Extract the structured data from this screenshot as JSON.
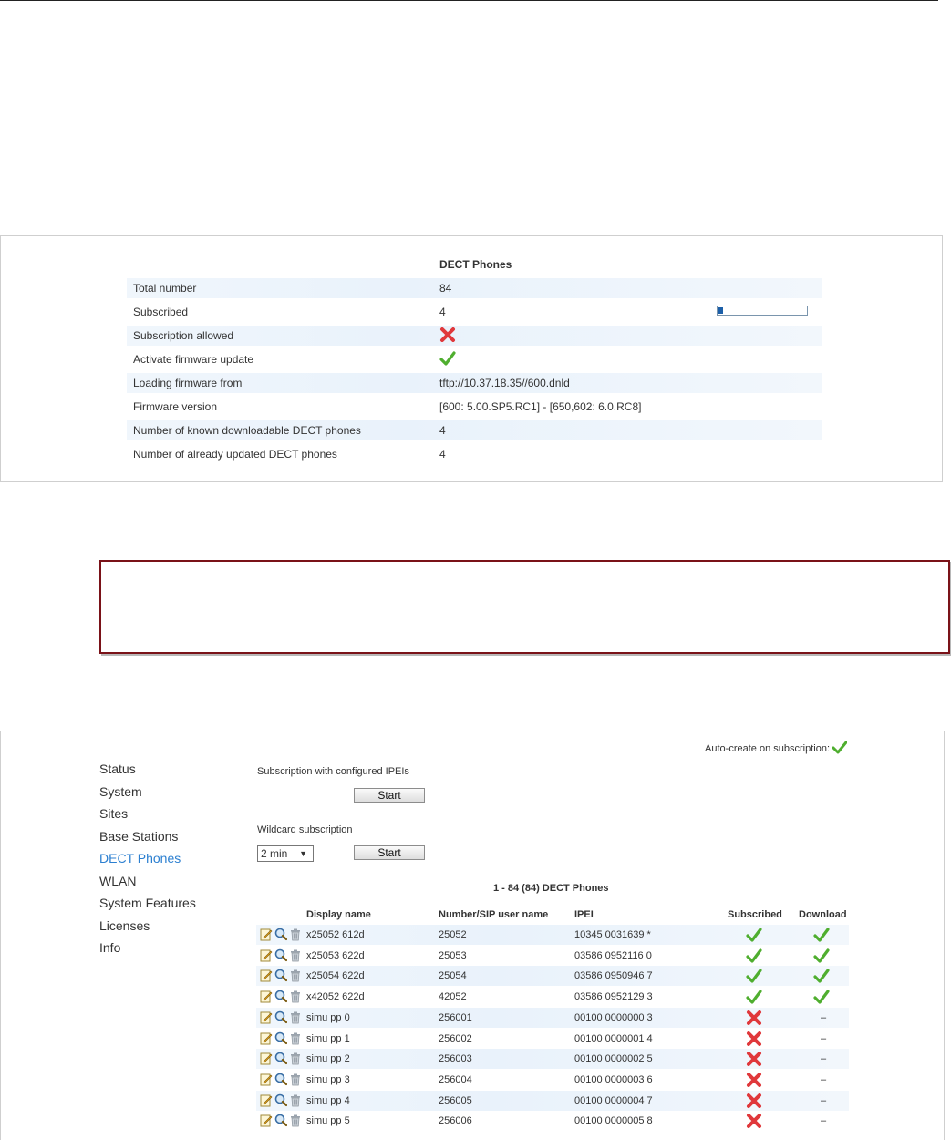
{
  "dect_panel": {
    "heading": "DECT Phones",
    "rows": [
      {
        "label": "Total number",
        "value": "84"
      },
      {
        "label": "Subscribed",
        "value": "4"
      },
      {
        "label": "Subscription allowed",
        "value": ""
      },
      {
        "label": "Activate firmware update",
        "value": ""
      },
      {
        "label": "Loading firmware from",
        "value": "tftp://10.37.18.35//600.dnld"
      },
      {
        "label": "Firmware version",
        "value": "[600: 5.00.SP5.RC1] - [650,602: 6.0.RC8]"
      },
      {
        "label": "Number of known downloadable DECT phones",
        "value": "4"
      },
      {
        "label": "Number of already updated DECT phones",
        "value": "4"
      }
    ],
    "subscribed_progress_fraction": 0.05,
    "subscription_allowed_icon": "red-cross-icon",
    "firmware_update_icon": "green-check-icon"
  },
  "nav": {
    "items": [
      "Status",
      "System",
      "Sites",
      "Base Stations",
      "DECT Phones",
      "WLAN",
      "System Features",
      "Licenses",
      "Info"
    ],
    "active": "DECT Phones"
  },
  "subscription": {
    "auto_create_label": "Auto-create on subscription:",
    "configured_label": "Subscription with configured IPEIs",
    "start_label": "Start",
    "wildcard_label": "Wildcard subscription",
    "wildcard_duration": "2 min"
  },
  "phones_table": {
    "title": "1 - 84 (84) DECT Phones",
    "headers": [
      "Display name",
      "Number/SIP user name",
      "IPEI",
      "Subscribed",
      "Download"
    ],
    "rows": [
      {
        "name": "x25052 612d",
        "number": "25052",
        "ipei": "10345 0031639 *",
        "subscribed": true,
        "download": "ok"
      },
      {
        "name": "x25053 622d",
        "number": "25053",
        "ipei": "03586 0952116 0",
        "subscribed": true,
        "download": "ok"
      },
      {
        "name": "x25054 622d",
        "number": "25054",
        "ipei": "03586 0950946 7",
        "subscribed": true,
        "download": "ok"
      },
      {
        "name": "x42052 622d",
        "number": "42052",
        "ipei": "03586 0952129 3",
        "subscribed": true,
        "download": "ok"
      },
      {
        "name": "simu pp 0",
        "number": "256001",
        "ipei": "00100 0000000 3",
        "subscribed": false,
        "download": "–"
      },
      {
        "name": "simu pp 1",
        "number": "256002",
        "ipei": "00100 0000001 4",
        "subscribed": false,
        "download": "–"
      },
      {
        "name": "simu pp 2",
        "number": "256003",
        "ipei": "00100 0000002 5",
        "subscribed": false,
        "download": "–"
      },
      {
        "name": "simu pp 3",
        "number": "256004",
        "ipei": "00100 0000003 6",
        "subscribed": false,
        "download": "–"
      },
      {
        "name": "simu pp 4",
        "number": "256005",
        "ipei": "00100 0000004 7",
        "subscribed": false,
        "download": "–"
      },
      {
        "name": "simu pp 5",
        "number": "256006",
        "ipei": "00100 0000005 8",
        "subscribed": false,
        "download": "–"
      }
    ]
  }
}
